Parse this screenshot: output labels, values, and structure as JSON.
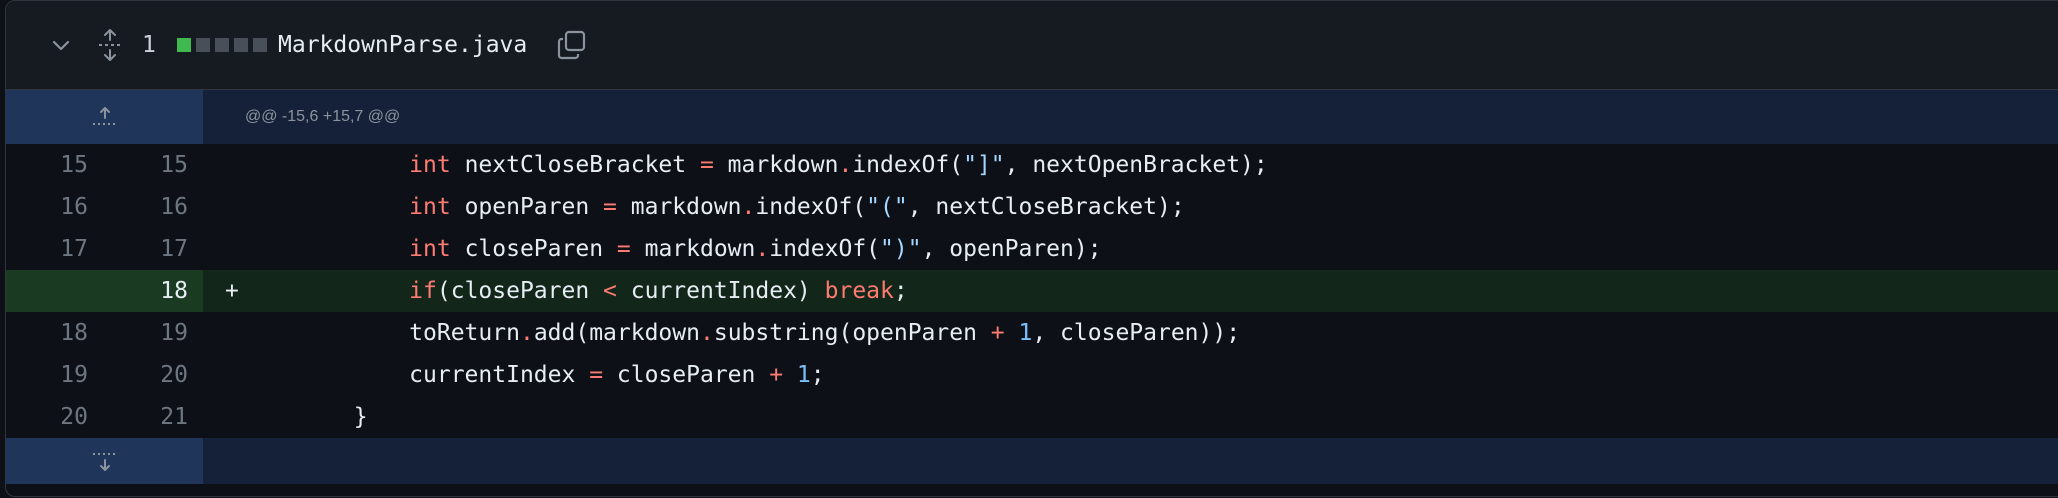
{
  "file": {
    "change_count": "1",
    "stat_blocks": [
      "add",
      "neutral",
      "neutral",
      "neutral",
      "neutral"
    ],
    "name": "MarkdownParse.java"
  },
  "hunk_header": "@@ -15,6 +15,7 @@",
  "lines": [
    {
      "old": "15",
      "new": "15",
      "marker": "",
      "type": "context"
    },
    {
      "old": "16",
      "new": "16",
      "marker": "",
      "type": "context"
    },
    {
      "old": "17",
      "new": "17",
      "marker": "",
      "type": "context"
    },
    {
      "old": "",
      "new": "18",
      "marker": "+",
      "type": "added"
    },
    {
      "old": "18",
      "new": "19",
      "marker": "",
      "type": "context"
    },
    {
      "old": "19",
      "new": "20",
      "marker": "",
      "type": "context"
    },
    {
      "old": "20",
      "new": "21",
      "marker": "",
      "type": "context"
    }
  ],
  "code": {
    "l1": {
      "indent": "            ",
      "kw": "int",
      "a": " nextCloseBracket ",
      "op1": "=",
      "b": " markdown",
      "op2": ".",
      "c": "indexOf(",
      "s": "\"]\"",
      "d": ", nextOpenBracket);"
    },
    "l2": {
      "indent": "            ",
      "kw": "int",
      "a": " openParen ",
      "op1": "=",
      "b": " markdown",
      "op2": ".",
      "c": "indexOf(",
      "s": "\"(\"",
      "d": ", nextCloseBracket);"
    },
    "l3": {
      "indent": "            ",
      "kw": "int",
      "a": " closeParen ",
      "op1": "=",
      "b": " markdown",
      "op2": ".",
      "c": "indexOf(",
      "s": "\")\"",
      "d": ", openParen);"
    },
    "l4": {
      "indent": "            ",
      "kw": "if",
      "a": "(closeParen ",
      "op1": "<",
      "b": " currentIndex) ",
      "kw2": "break",
      "d": ";"
    },
    "l5": {
      "indent": "            ",
      "a": "toReturn",
      "op2": ".",
      "b": "add(markdown",
      "op3": ".",
      "c": "substring(openParen ",
      "op1": "+",
      "n": " 1",
      "d": ", closeParen));"
    },
    "l6": {
      "indent": "            ",
      "a": "currentIndex ",
      "op1": "=",
      "b": " closeParen ",
      "op2": "+",
      "n": " 1",
      "d": ";"
    },
    "l7": {
      "indent": "        ",
      "a": "}"
    }
  },
  "colors": {
    "keyword": "#ff7b72",
    "string": "#a5d6ff",
    "number": "#79c0ff",
    "added_bg": "#12261a",
    "hunk_bg": "#152138"
  },
  "icons": [
    "chevron-down-icon",
    "expand-icon",
    "copy-icon",
    "expand-up-icon",
    "expand-down-icon"
  ]
}
